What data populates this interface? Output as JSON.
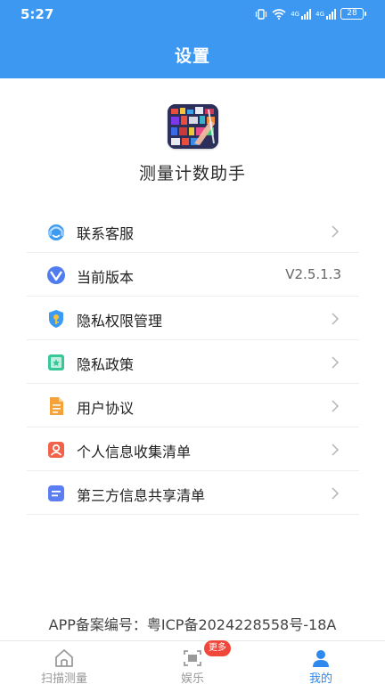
{
  "status_bar": {
    "time": "5:27",
    "battery": "28",
    "network_1": "4G",
    "network_2": "4G"
  },
  "header": {
    "title": "设置"
  },
  "app": {
    "name": "测量计数助手",
    "icon": "app-logo-icon"
  },
  "menu": [
    {
      "label": "联系客服",
      "icon": "headset-icon",
      "value": ""
    },
    {
      "label": "当前版本",
      "icon": "version-icon",
      "value": "V2.5.1.3"
    },
    {
      "label": "隐私权限管理",
      "icon": "shield-key-icon",
      "value": ""
    },
    {
      "label": "隐私政策",
      "icon": "privacy-policy-icon",
      "value": ""
    },
    {
      "label": "用户协议",
      "icon": "document-icon",
      "value": ""
    },
    {
      "label": "个人信息收集清单",
      "icon": "person-card-icon",
      "value": ""
    },
    {
      "label": "第三方信息共享清单",
      "icon": "list-icon",
      "value": ""
    }
  ],
  "footer": {
    "icp": "APP备案编号：粤ICP备2024228558号-18A"
  },
  "tabbar": {
    "tabs": [
      {
        "label": "扫描测量",
        "icon": "home-icon",
        "active": false
      },
      {
        "label": "娱乐",
        "icon": "scan-frame-icon",
        "active": false,
        "badge": "更多"
      },
      {
        "label": "我的",
        "icon": "person-icon",
        "active": true
      }
    ]
  },
  "colors": {
    "accent": "#3d98f2",
    "active_tab": "#2f88ee",
    "badge": "#f0473a"
  }
}
